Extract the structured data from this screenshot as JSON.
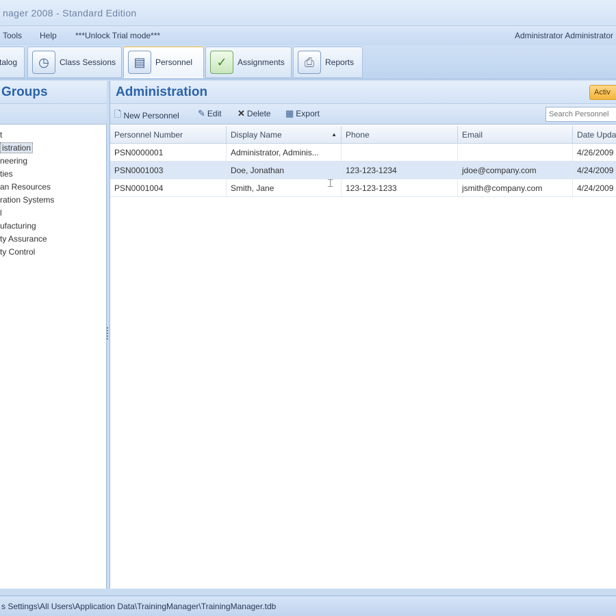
{
  "window": {
    "title": "nager 2008 - Standard Edition"
  },
  "menu": {
    "items": [
      "Tools",
      "Help",
      "***Unlock Trial mode***"
    ],
    "user": "Administrator Administrator"
  },
  "ribbon": {
    "tabs": [
      {
        "label": "talog",
        "icon": "catalog-icon"
      },
      {
        "label": "Class Sessions",
        "icon": "clock-icon"
      },
      {
        "label": "Personnel",
        "icon": "personnel-icon",
        "active": true
      },
      {
        "label": "Assignments",
        "icon": "checklist-icon"
      },
      {
        "label": "Reports",
        "icon": "printer-icon"
      }
    ]
  },
  "left_panel": {
    "title": "Groups",
    "items": [
      {
        "label": "t",
        "selected": false
      },
      {
        "label": "istration",
        "selected": true
      },
      {
        "label": "neering",
        "selected": false
      },
      {
        "label": "ties",
        "selected": false
      },
      {
        "label": "an Resources",
        "selected": false
      },
      {
        "label": "ration Systems",
        "selected": false
      },
      {
        "label": "l",
        "selected": false
      },
      {
        "label": "ufacturing",
        "selected": false
      },
      {
        "label": "ty Assurance",
        "selected": false
      },
      {
        "label": "ty Control",
        "selected": false
      }
    ]
  },
  "main": {
    "title": "Administration",
    "badge": "Activ",
    "toolbar": {
      "new": "New Personnel",
      "edit": "Edit",
      "delete": "Delete",
      "export": "Export"
    },
    "search_placeholder": "Search Personnel",
    "columns": [
      "Personnel Number",
      "Display Name",
      "Phone",
      "Email",
      "Date Upda"
    ],
    "rows": [
      {
        "number": "PSN0000001",
        "name": "Administrator, Adminis...",
        "phone": "",
        "email": "",
        "date": "4/26/2009",
        "selected": false
      },
      {
        "number": "PSN0001003",
        "name": "Doe, Jonathan",
        "phone": "123-123-1234",
        "email": "jdoe@company.com",
        "date": "4/24/2009",
        "selected": true
      },
      {
        "number": "PSN0001004",
        "name": "Smith, Jane",
        "phone": "123-123-1233",
        "email": "jsmith@company.com",
        "date": "4/24/2009",
        "selected": false
      }
    ]
  },
  "status": {
    "text": "s Settings\\All Users\\Application Data\\TrainingManager\\TrainingManager.tdb"
  },
  "colors": {
    "accent": "#2b63a8",
    "active_tab_border": "#f0b640",
    "selection": "#dbe7f6"
  }
}
